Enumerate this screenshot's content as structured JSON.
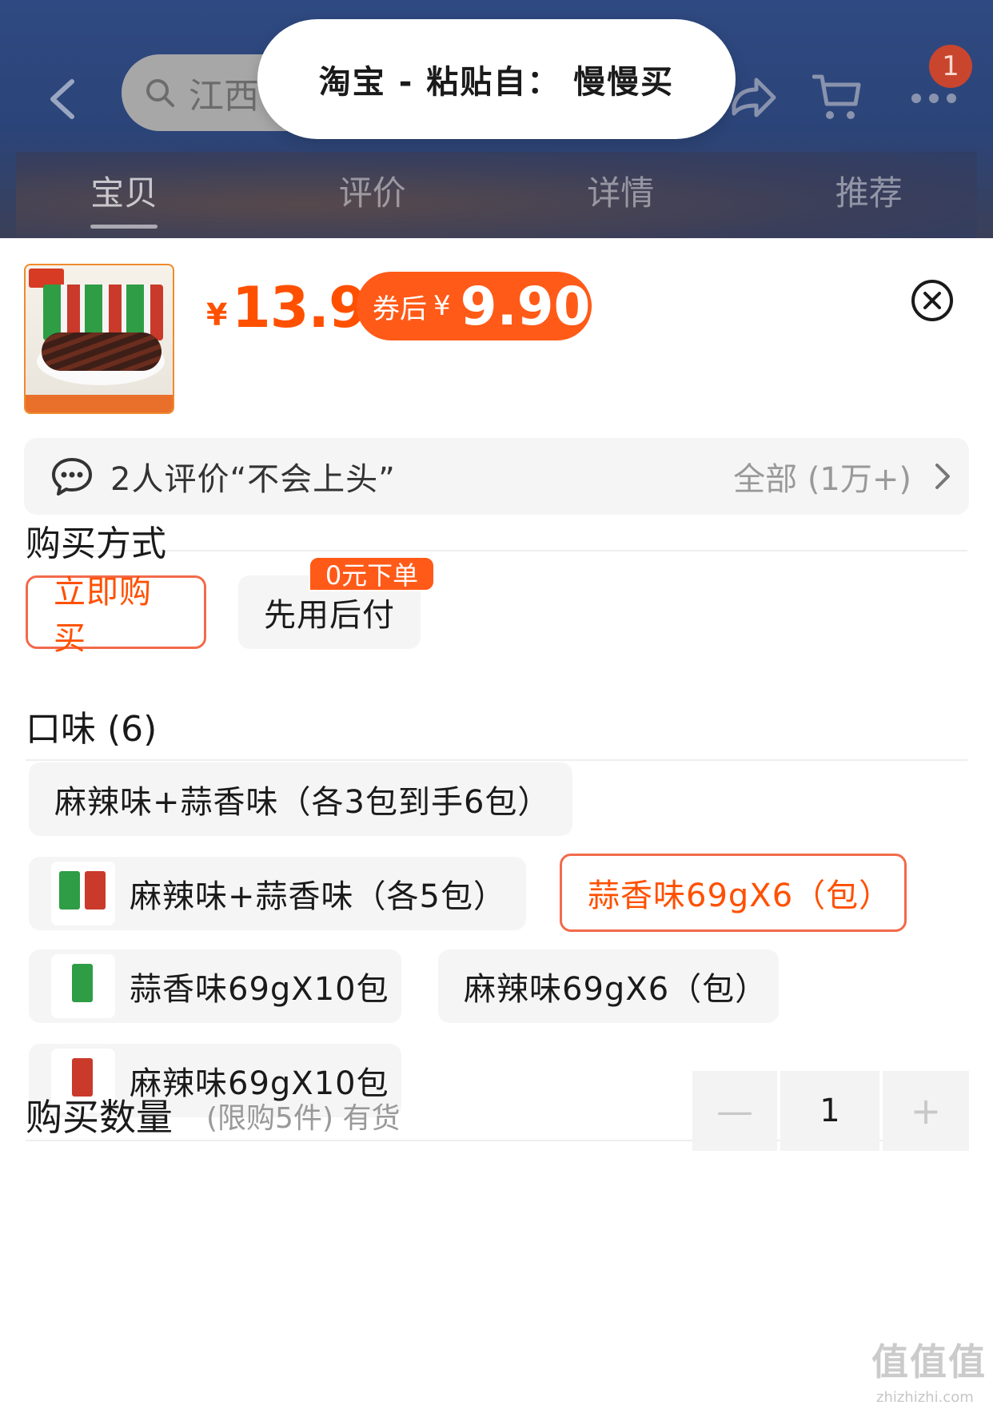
{
  "header": {
    "search_text": "江西",
    "cart_badge": "1",
    "tabs": [
      "宝贝",
      "评价",
      "详情",
      "推荐"
    ]
  },
  "toast": {
    "text": "淘宝 - 粘贴自： 慢慢买"
  },
  "product": {
    "price_symbol": "¥",
    "price": "13.9",
    "coupon_label": "券后",
    "coupon_symbol": "¥",
    "coupon_price": "9.90"
  },
  "review": {
    "summary": "2人评价“不会上头”",
    "all_label": "全部 (1万+)"
  },
  "purchase_method": {
    "title": "购买方式",
    "options": [
      "立即购买",
      "先用后付"
    ],
    "badge": "0元下单"
  },
  "flavor": {
    "title": "口味 (6)",
    "options": [
      "麻辣味+蒜香味（各3包到手6包）",
      "麻辣味+蒜香味（各5包）",
      "蒜香味69gX6（包）",
      "蒜香味69gX10包",
      "麻辣味69gX6（包）",
      "麻辣味69gX10包"
    ],
    "selected": "蒜香味69gX6（包）"
  },
  "quantity": {
    "title": "购买数量",
    "note": "(限购5件) 有货",
    "value": "1",
    "minus": "—",
    "plus": "+"
  },
  "watermark": {
    "text": "值值值",
    "url": "zhizhizhi.com"
  },
  "colors": {
    "accent": "#ff5000",
    "header_bg": "#2f4a82"
  }
}
